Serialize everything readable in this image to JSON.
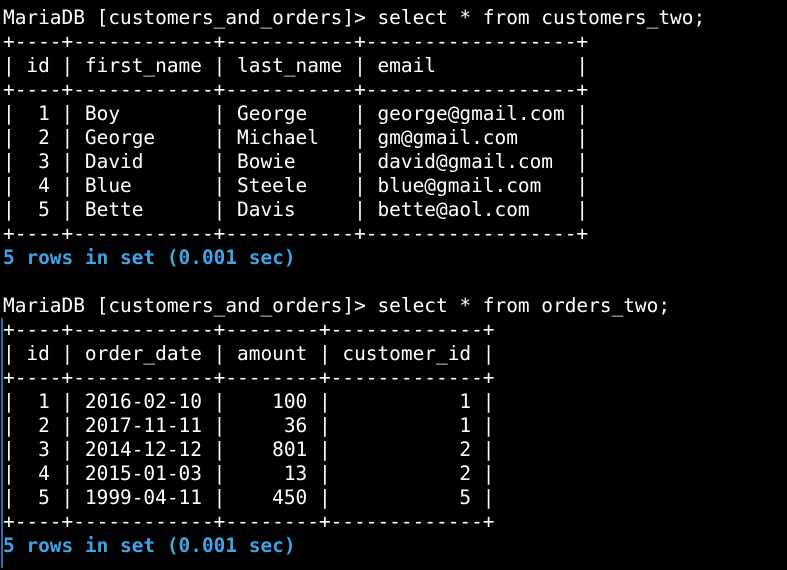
{
  "colors": {
    "background": "#000000",
    "text": "#ffffff",
    "status": "#3ea4e6"
  },
  "query1": {
    "prompt": "MariaDB [customers_and_orders]> select * from customers_two;",
    "border": "+----+------------+-----------+------------------+",
    "header": "| id | first_name | last_name | email            |",
    "rows": [
      "|  1 | Boy        | George    | george@gmail.com |",
      "|  2 | George     | Michael   | gm@gmail.com     |",
      "|  3 | David      | Bowie     | david@gmail.com  |",
      "|  4 | Blue       | Steele    | blue@gmail.com   |",
      "|  5 | Bette      | Davis     | bette@aol.com    |"
    ],
    "status": "5 rows in set (0.001 sec)"
  },
  "query2": {
    "prompt": "MariaDB [customers_and_orders]> select * from orders_two;",
    "border": "+----+------------+--------+-------------+",
    "header": "| id | order_date | amount | customer_id |",
    "rows": [
      "|  1 | 2016-02-10 |    100 |           1 |",
      "|  2 | 2017-11-11 |     36 |           1 |",
      "|  3 | 2014-12-12 |    801 |           2 |",
      "|  4 | 2015-01-03 |     13 |           2 |",
      "|  5 | 1999-04-11 |    450 |           5 |"
    ],
    "status": "5 rows in set (0.001 sec)"
  }
}
